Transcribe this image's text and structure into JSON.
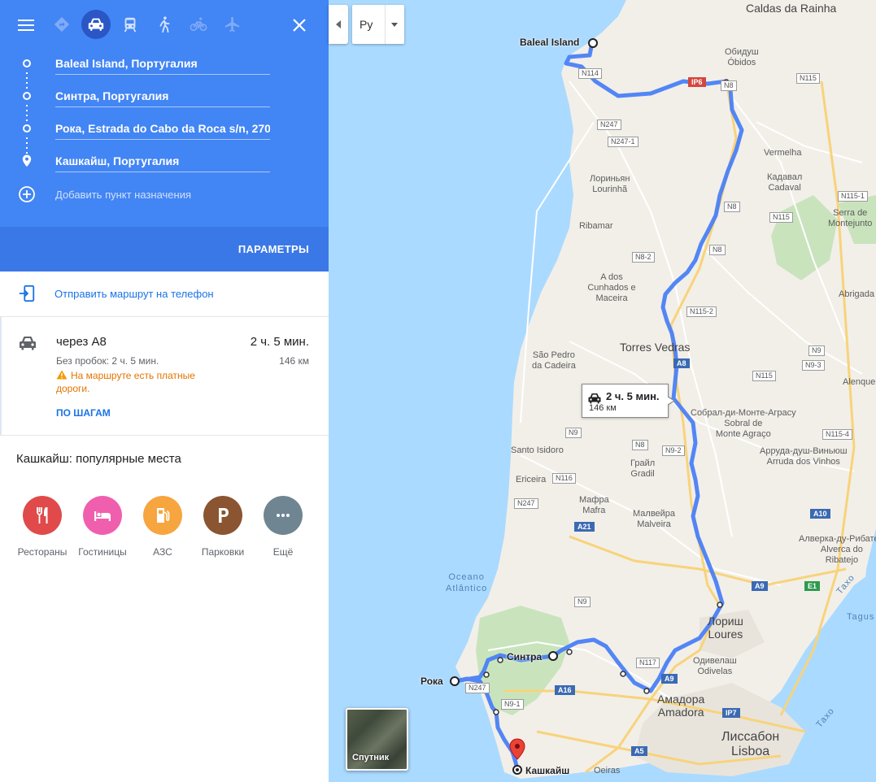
{
  "header": {
    "modes": [
      {
        "name": "mode-best",
        "icon": "directions-diamond-icon"
      },
      {
        "name": "mode-driving",
        "icon": "car-icon",
        "active": true
      },
      {
        "name": "mode-transit",
        "icon": "train-icon"
      },
      {
        "name": "mode-walking",
        "icon": "walk-icon"
      },
      {
        "name": "mode-cycling",
        "icon": "bike-icon"
      },
      {
        "name": "mode-flights",
        "icon": "plane-icon"
      }
    ],
    "stops": [
      "Baleal Island, Португалия",
      "Синтра, Португалия",
      "Рока, Estrada do Cabo da Roca s/n, 270",
      "Кашкайш, Португалия"
    ],
    "add_destination": "Добавить пункт назначения",
    "options_label": "ПАРАМЕТРЫ"
  },
  "send_to_phone": "Отправить маршрут на телефон",
  "route": {
    "via": "через A8",
    "time": "2 ч. 5 мин.",
    "traffic": "Без пробок: 2 ч. 5 мин.",
    "distance": "146 км",
    "warning": "На маршруте есть платные дороги.",
    "steps_label": "ПО ШАГАМ"
  },
  "popular": {
    "title": "Кашкайш: популярные места",
    "categories": [
      {
        "label": "Рестораны",
        "color": "#e04a4a",
        "icon": "restaurant-icon"
      },
      {
        "label": "Гостиницы",
        "color": "#f05fae",
        "icon": "hotel-icon"
      },
      {
        "label": "АЗС",
        "color": "#f6a53f",
        "icon": "gas-station-icon"
      },
      {
        "label": "Парковки",
        "color": "#8a5530",
        "icon": "parking-icon"
      },
      {
        "label": "Ещё",
        "color": "#6f8591",
        "icon": "more-icon"
      }
    ]
  },
  "map": {
    "language": "Ру",
    "callout": {
      "time": "2 ч. 5 мин.",
      "distance": "146 км"
    },
    "satellite_label": "Спутник",
    "waypoints": [
      "Baleal Island",
      "Синтра",
      "Рока",
      "Кашкайш"
    ],
    "towns": [
      "Caldas da Rainha",
      "Обидуш",
      "Óbidos",
      "Vermelha",
      "Кадавал",
      "Cadaval",
      "Лориньян",
      "Lourinhã",
      "Ribamar",
      "A dos Cunhados e Maceira",
      "Torres Vedras",
      "São Pedro da Cadeira",
      "Собрал-ди-Монте-Аграсу",
      "Sobral de Monte Agraço",
      "Santo Isidoro",
      "Грайл",
      "Gradil",
      "Ericeira",
      "Мафра",
      "Mafra",
      "Малвейра",
      "Malveira",
      "Арруда-душ-Виньюш",
      "Arruda dos Vinhos",
      "Serra de",
      "Montejunto",
      "Abrigada",
      "Alenque",
      "Алверка-ду-Рибатеж",
      "Alverca do",
      "Ribatejo",
      "Лориш",
      "Loures",
      "Одивелаш",
      "Odivelas",
      "Амадора",
      "Amadora",
      "Лиссабон",
      "Lisboa",
      "Oeiras",
      "Tagus",
      "Тахо",
      "Oceano",
      "Atlântico"
    ],
    "roads": [
      "N114",
      "IP6",
      "N8",
      "N115",
      "N247",
      "N247-1",
      "N115-1",
      "N115",
      "N8-2",
      "N115-2",
      "A8",
      "N9",
      "N9-3",
      "N115-4",
      "N9-2",
      "N116",
      "N247",
      "A21",
      "A10",
      "A9",
      "E1",
      "N117",
      "N247",
      "A16",
      "N9-1",
      "IP7",
      "A5"
    ]
  }
}
